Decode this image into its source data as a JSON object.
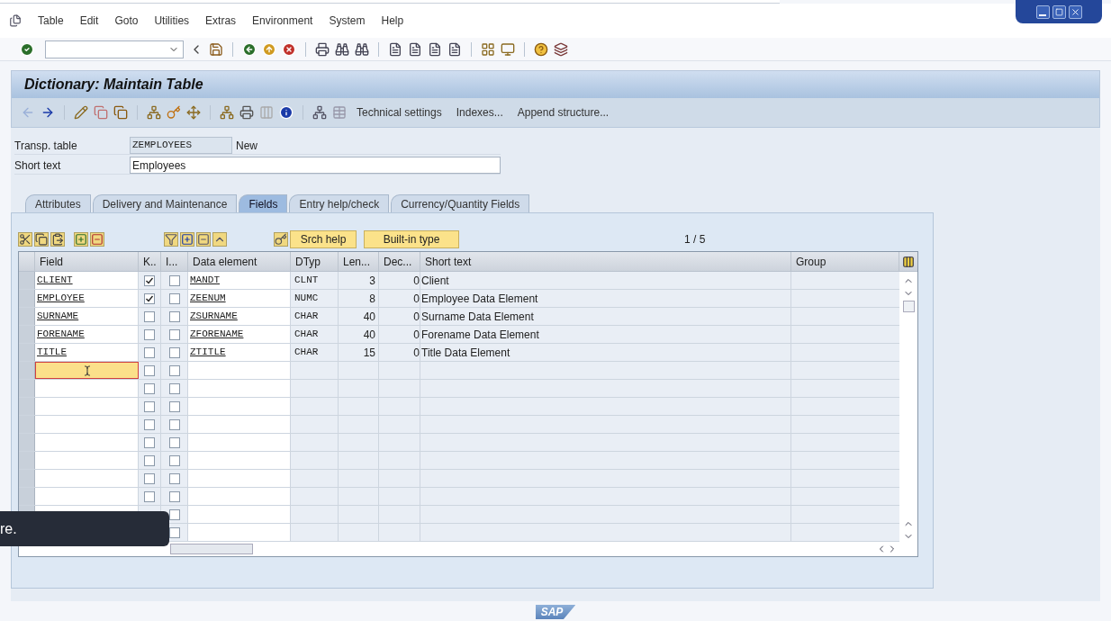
{
  "menu": [
    "Table",
    "Edit",
    "Goto",
    "Utilities",
    "Extras",
    "Environment",
    "System",
    "Help"
  ],
  "title": "Dictionary: Maintain Table",
  "app_actions": [
    "Technical settings",
    "Indexes...",
    "Append structure..."
  ],
  "header_fields": [
    {
      "label": "Transp. table",
      "value": "ZEMPLOYEES",
      "status": "New",
      "editable": false
    },
    {
      "label": "Short text",
      "value": "Employees",
      "editable": true
    }
  ],
  "tabs": [
    {
      "label": "Attributes",
      "selected": false
    },
    {
      "label": "Delivery and Maintenance",
      "selected": false
    },
    {
      "label": "Fields",
      "selected": true
    },
    {
      "label": "Entry help/check",
      "selected": false
    },
    {
      "label": "Currency/Quantity Fields",
      "selected": false
    }
  ],
  "table_toolbar": {
    "buttons": [
      "Srch help",
      "Built-in type"
    ],
    "page": "1 / 5"
  },
  "table": {
    "columns": [
      "Field",
      "K..",
      "I...",
      "Data element",
      "DTyp",
      "Len...",
      "Dec...",
      "Short text",
      "Group"
    ],
    "rows": [
      {
        "field": "CLIENT",
        "key": true,
        "initial": false,
        "data_element": "MANDT",
        "dtyp": "CLNT",
        "length": "3",
        "decimals": "0",
        "short_text": "Client",
        "focused": false
      },
      {
        "field": "EMPLOYEE",
        "key": true,
        "initial": false,
        "data_element": "ZEENUM",
        "dtyp": "NUMC",
        "length": "8",
        "decimals": "0",
        "short_text": "Employee Data Element",
        "focused": false
      },
      {
        "field": "SURNAME",
        "key": false,
        "initial": false,
        "data_element": "ZSURNAME",
        "dtyp": "CHAR",
        "length": "40",
        "decimals": "0",
        "short_text": "Surname Data Element",
        "focused": false
      },
      {
        "field": "FORENAME",
        "key": false,
        "initial": false,
        "data_element": "ZFORENAME",
        "dtyp": "CHAR",
        "length": "40",
        "decimals": "0",
        "short_text": "Forename Data Element",
        "focused": false
      },
      {
        "field": "TITLE",
        "key": false,
        "initial": false,
        "data_element": "ZTITLE",
        "dtyp": "CHAR",
        "length": "15",
        "decimals": "0",
        "short_text": "Title Data Element",
        "focused": false
      },
      {
        "key": false,
        "initial": false,
        "focused": true
      },
      {
        "key": false,
        "initial": false,
        "focused": false
      },
      {
        "key": false,
        "initial": false,
        "focused": false
      },
      {
        "key": false,
        "initial": false,
        "focused": false
      },
      {
        "key": false,
        "initial": false,
        "focused": false
      },
      {
        "key": false,
        "initial": false,
        "focused": false
      },
      {
        "key": false,
        "initial": false,
        "focused": false
      },
      {
        "key": false,
        "initial": false,
        "focused": false
      },
      {
        "initial": false
      },
      {
        "initial": false
      }
    ]
  },
  "caption": "re.",
  "footer_logo": "SAP"
}
